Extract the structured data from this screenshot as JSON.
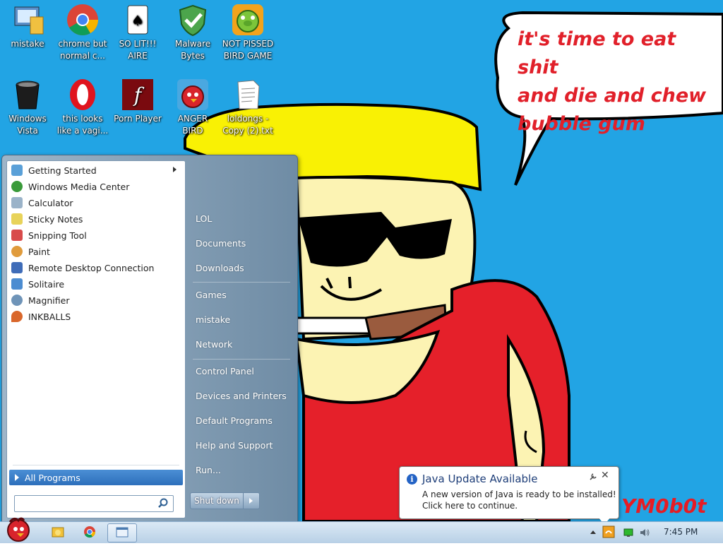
{
  "desktop": {
    "speech_text": "it's time to eat shit\nand die and chew\nbubble gum",
    "watermark": "YM0b0t",
    "icons": [
      {
        "label": "mistake",
        "icon": "computer-folder-icon"
      },
      {
        "label": "chrome but\nnormal c...",
        "icon": "chrome-icon"
      },
      {
        "label": "SO LIT!!!\nAIRE",
        "icon": "solitaire-icon"
      },
      {
        "label": "Malware\nBytes",
        "icon": "shield-icon"
      },
      {
        "label": "NOT PISSED\nBIRD GAME",
        "icon": "green-pig-icon"
      },
      {
        "label": "Windows\nVista",
        "icon": "recycle-bin-icon"
      },
      {
        "label": "this looks\nlike a vagi...",
        "icon": "opera-icon"
      },
      {
        "label": "Porn Player",
        "icon": "flash-icon"
      },
      {
        "label": "ANGER\nBIRD",
        "icon": "angry-bird-icon"
      },
      {
        "label": "loldongs -\nCopy (2).txt",
        "icon": "text-file-icon"
      }
    ]
  },
  "start_menu": {
    "programs": [
      {
        "label": "Getting Started",
        "has_submenu": true,
        "color": "#5aa0d8"
      },
      {
        "label": "Windows Media Center",
        "color": "#3a9a3a"
      },
      {
        "label": "Calculator",
        "color": "#9bb3c9"
      },
      {
        "label": "Sticky Notes",
        "color": "#e8d35a"
      },
      {
        "label": "Snipping Tool",
        "color": "#d84b4b"
      },
      {
        "label": "Paint",
        "color": "#e09b3c"
      },
      {
        "label": "Remote Desktop Connection",
        "color": "#3f6cb8"
      },
      {
        "label": "Solitaire",
        "color": "#4c8cd1"
      },
      {
        "label": "Magnifier",
        "color": "#6f94b8"
      },
      {
        "label": "INKBALLS",
        "color": "#d9672b"
      }
    ],
    "all_programs": "All Programs",
    "search_placeholder": "",
    "right_items": [
      "LOL",
      "Documents",
      "Downloads",
      "Games",
      "mistake",
      "Network",
      "Control Panel",
      "Devices and Printers",
      "Default Programs",
      "Help and Support",
      "Run..."
    ],
    "shutdown": "Shut down"
  },
  "notification": {
    "title": "Java Update Available",
    "message": "A new version of Java is ready to be installed!\nClick here to continue."
  },
  "taskbar": {
    "clock": "7:45 PM",
    "accent": "#2d6fbb"
  }
}
